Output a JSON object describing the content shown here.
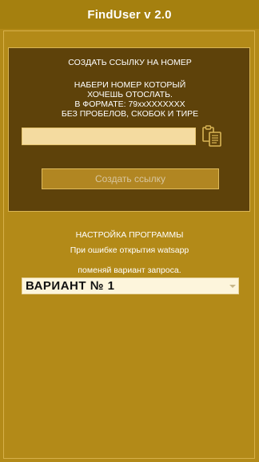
{
  "app": {
    "title": "FindUser v 2.0"
  },
  "link_panel": {
    "heading": "СОЗДАТЬ ССЫЛКУ НА НОМЕР",
    "instruction_lines": [
      "НАБЕРИ НОМЕР КОТОРЫЙ",
      "ХОЧЕШЬ ОТОСЛАТЬ.",
      "В ФОРМАТЕ:  79xxXXXXXXX",
      "БЕЗ ПРОБЕЛОВ, СКОБОК И ТИРЕ"
    ],
    "phone_input": {
      "value": "",
      "placeholder": ""
    },
    "paste_icon": "clipboard-paste-icon",
    "create_button_label": "Создать ссылку"
  },
  "settings": {
    "heading": "НАСТРОЙКА ПРОГРАММЫ",
    "note_line1": "При ошибке открытия watsapp",
    "note_line2": "поменяй вариант запроса.",
    "variant_selected": "ВАРИАНТ № 1"
  },
  "colors": {
    "background": "#b38a18",
    "titlebar": "#a5800f",
    "panel": "#5e420a",
    "input": "#f4dba0",
    "button": "#b18622"
  }
}
